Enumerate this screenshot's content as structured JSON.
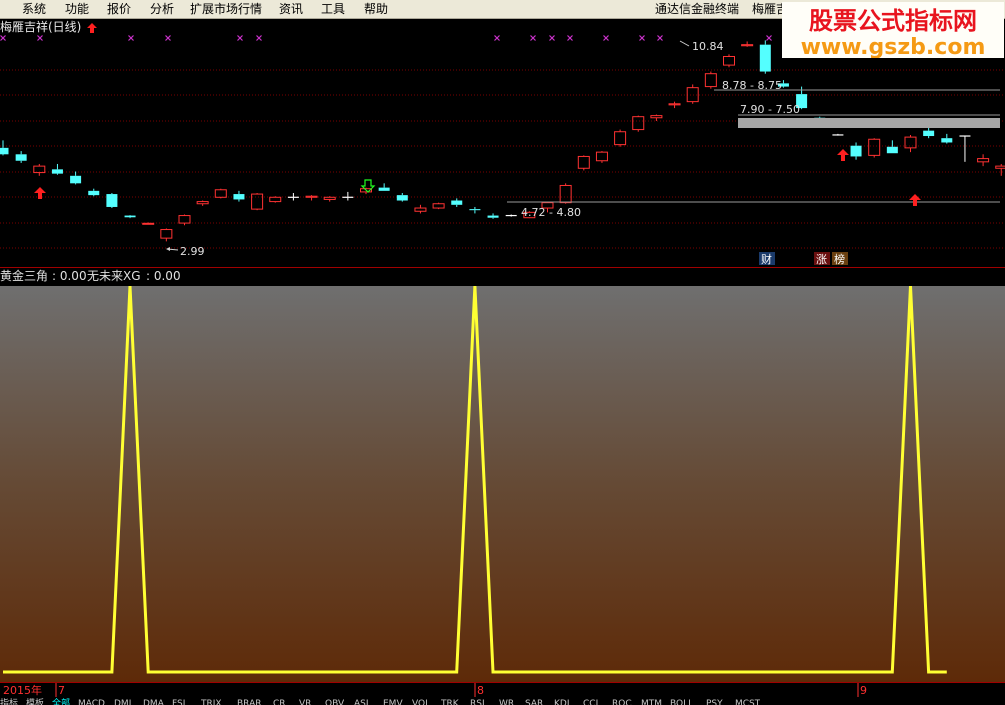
{
  "menu": {
    "items": [
      "系统",
      "功能",
      "报价",
      "分析",
      "扩展市场行情",
      "资讯",
      "工具",
      "帮助"
    ],
    "right_items": [
      "通达信金融终端",
      "梅雁吉祥"
    ]
  },
  "watermark": {
    "line1": "股票公式指标网",
    "line2": "www.gszb.com"
  },
  "main_chart": {
    "title": "梅雁吉祥(日线)",
    "annotations": {
      "high": "10.84",
      "range_1": "8.78 - 8.75",
      "range_2": "7.90 - 7.50",
      "range_low": "4.72 - 4.80",
      "low": "2.99"
    },
    "badges": [
      "财",
      "涨",
      "榜"
    ],
    "colors": {
      "up": "#ff3232",
      "down": "#54ffff",
      "cross": "#cc33cc",
      "grid": "#7a0000"
    }
  },
  "indicator": {
    "name": "黄金三角",
    "value_1": ": 0.00",
    "label_2": "无未来XG",
    "value_2": ": 0.00",
    "line_color": "#ffff33"
  },
  "time_axis": {
    "year": "2015年",
    "month_7": "7",
    "month_8": "8",
    "month_9": "9"
  },
  "tabs": [
    "指标",
    "模板",
    "全部",
    "MACD",
    "DMI",
    "DMA",
    "FSL",
    "TRIX",
    "BRAR",
    "CR",
    "VR",
    "OBV",
    "ASI",
    "EMV",
    "VOL",
    "TRK",
    "RSI",
    "WR",
    "SAR",
    "KDJ",
    "CCI",
    "ROC",
    "MTM",
    "BOLL",
    "PSY",
    "MCST"
  ],
  "chart_data": {
    "type": "candlestick",
    "title": "梅雁吉祥(日线)",
    "series": [
      {
        "values": [
          [
            8.05,
            8.4,
            7.7,
            7.75
          ],
          [
            7.75,
            7.9,
            7.35,
            7.45
          ],
          [
            6.9,
            7.3,
            6.75,
            7.2
          ],
          [
            7.05,
            7.3,
            6.8,
            6.85
          ],
          [
            6.75,
            6.95,
            6.35,
            6.4
          ],
          [
            6.05,
            6.15,
            5.8,
            5.85
          ],
          [
            5.9,
            5.95,
            5.25,
            5.3
          ],
          [
            4.9,
            4.92,
            4.78,
            4.82
          ],
          [
            4.52,
            4.58,
            4.5,
            4.54
          ],
          [
            3.85,
            4.3,
            3.7,
            4.25
          ],
          [
            4.55,
            4.95,
            4.45,
            4.9
          ],
          [
            5.45,
            5.6,
            5.35,
            5.55
          ],
          [
            5.75,
            6.15,
            5.7,
            6.1
          ],
          [
            5.9,
            6.05,
            5.55,
            5.65
          ],
          [
            5.2,
            5.95,
            5.15,
            5.9
          ],
          [
            5.55,
            5.8,
            5.5,
            5.75
          ],
          [
            5.75,
            5.95,
            5.6,
            5.75
          ],
          [
            5.75,
            5.85,
            5.6,
            5.8
          ],
          [
            5.65,
            5.8,
            5.55,
            5.75
          ],
          [
            5.75,
            6.0,
            5.6,
            5.75
          ],
          [
            6.0,
            6.2,
            5.9,
            6.15
          ],
          [
            6.2,
            6.4,
            6.05,
            6.05
          ],
          [
            5.85,
            5.95,
            5.55,
            5.6
          ],
          [
            5.1,
            5.4,
            5.0,
            5.25
          ],
          [
            5.25,
            5.5,
            5.2,
            5.45
          ],
          [
            5.6,
            5.7,
            5.3,
            5.4
          ],
          [
            5.2,
            5.3,
            5.0,
            5.15
          ],
          [
            4.9,
            5.0,
            4.75,
            4.8
          ],
          [
            4.9,
            4.95,
            4.85,
            4.9
          ],
          [
            4.8,
            5.1,
            4.78,
            5.05
          ],
          [
            5.25,
            5.55,
            5.05,
            5.5
          ],
          [
            5.5,
            6.4,
            5.45,
            6.3
          ],
          [
            7.1,
            7.7,
            7.0,
            7.65
          ],
          [
            7.45,
            7.9,
            7.35,
            7.85
          ],
          [
            8.2,
            8.9,
            8.1,
            8.8
          ],
          [
            8.9,
            9.55,
            8.8,
            9.5
          ],
          [
            9.45,
            9.6,
            9.3,
            9.55
          ],
          [
            10.05,
            10.2,
            9.9,
            10.1
          ],
          [
            10.2,
            11.0,
            10.1,
            10.85
          ],
          [
            10.9,
            11.6,
            10.8,
            11.5
          ],
          [
            11.9,
            12.4,
            11.8,
            12.3
          ],
          [
            12.8,
            13.0,
            12.75,
            12.85
          ],
          [
            12.85,
            13.05,
            11.5,
            11.6
          ],
          [
            11.05,
            11.2,
            10.85,
            10.9
          ],
          [
            10.55,
            10.9,
            9.85,
            9.9
          ],
          [
            9.45,
            9.5,
            9.2,
            9.25
          ],
          [
            8.65,
            8.7,
            8.62,
            8.65
          ],
          [
            8.15,
            8.3,
            7.5,
            7.65
          ],
          [
            7.7,
            8.5,
            7.6,
            8.45
          ],
          [
            8.1,
            8.4,
            7.8,
            7.8
          ],
          [
            8.05,
            8.65,
            7.85,
            8.55
          ],
          [
            8.85,
            9.05,
            8.5,
            8.6
          ],
          [
            8.5,
            8.7,
            8.25,
            8.3
          ],
          [
            8.6,
            8.6,
            7.4,
            8.6
          ],
          [
            7.4,
            7.75,
            7.2,
            7.55
          ],
          [
            7.1,
            7.3,
            6.75,
            7.2
          ],
          [
            7.3,
            8.05,
            7.25,
            8.0
          ]
        ]
      }
    ],
    "columns": [
      "open",
      "high",
      "low",
      "close"
    ],
    "ylim": [
      2.6,
      13.3
    ]
  },
  "indicator_data": {
    "series": [
      {
        "name": "黄金三角",
        "values": [
          0,
          0,
          0,
          0,
          0,
          0,
          0,
          1,
          0,
          0,
          0,
          0,
          0,
          0,
          0,
          0,
          0,
          0,
          0,
          0,
          0,
          0,
          0,
          0,
          0,
          0,
          1,
          0,
          0,
          0,
          0,
          0,
          0,
          0,
          0,
          0,
          0,
          0,
          0,
          0,
          0,
          0,
          0,
          0,
          0,
          0,
          0,
          0,
          0,
          0,
          1,
          0,
          0
        ]
      }
    ]
  }
}
